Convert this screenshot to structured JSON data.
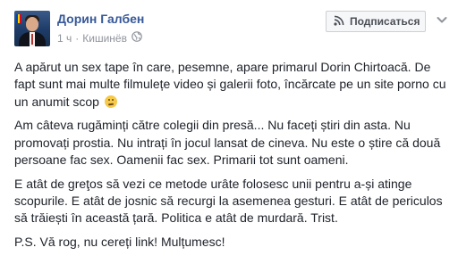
{
  "post": {
    "author_name": "Дорин Галбен",
    "time": "1 ч",
    "separator": "·",
    "location": "Кишинёв",
    "subscribe_label": "Подписаться",
    "paragraphs": [
      "A apărut un sex tape în care, pesemne, apare primarul Dorin Chirtoacă. De fapt sunt mai multe filmulețe video și galerii foto, încărcate pe un site porno cu un anumit scop",
      "Am câteva rugăminți către colegii din presă... Nu faceți știri din asta. Nu promovați prostia. Nu intrați în jocul lansat de cineva. Nu este o știre că două persoane fac sex. Oamenii fac sex. Primarii tot sunt oameni.",
      "E atât de greţos să vezi ce metode urâte folosesc unii pentru a-și atinge scopurile. E atât de josnic să recurgi la asemenea gesturi. E atât de periculos să trăiești în această țară. Politica e atât de murdară. Trist.",
      "P.S. Vă rog, nu cereți link! Mulțumesc!"
    ],
    "emoji": "unamused-face-icon",
    "colors": {
      "author": "#365899",
      "meta": "#90949c",
      "text": "#1d2129",
      "button_bg": "#f6f7f9",
      "button_border": "#ced0d4"
    }
  }
}
